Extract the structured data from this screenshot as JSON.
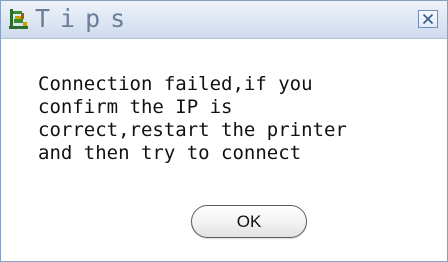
{
  "dialog": {
    "title": "Tips",
    "app_icon": "printer-figure-icon",
    "close_icon": "close-icon",
    "message_lines": [
      "Connection failed,if you",
      "confirm the IP is",
      "correct,restart the printer",
      "and then try to connect"
    ],
    "ok_label": "OK"
  },
  "colors": {
    "titlebar": "#dde6f3",
    "title_text": "#6a7f98",
    "border": "#8aa0bf",
    "close_border": "#6f8fb8"
  }
}
